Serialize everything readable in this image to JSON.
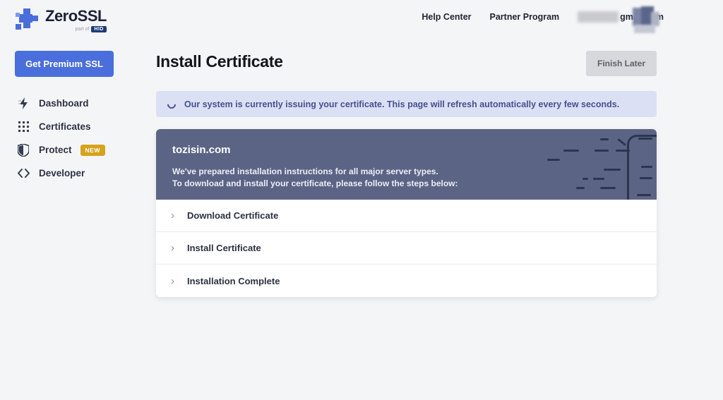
{
  "brand": {
    "name": "ZeroSSL",
    "part_of": "part of",
    "parent_badge": "HID"
  },
  "header": {
    "links": [
      {
        "label": "Help Center"
      },
      {
        "label": "Partner Program"
      }
    ],
    "account_email_visible": "gmail.com"
  },
  "sidebar": {
    "premium_button_label": "Get Premium SSL",
    "items": [
      {
        "label": "Dashboard",
        "icon": "lightning-icon"
      },
      {
        "label": "Certificates",
        "icon": "grid-icon"
      },
      {
        "label": "Protect",
        "icon": "shield-icon",
        "badge": "NEW"
      },
      {
        "label": "Developer",
        "icon": "code-icon"
      }
    ]
  },
  "main": {
    "title": "Install Certificate",
    "finish_later_label": "Finish Later",
    "banner": {
      "text": "Our system is currently issuing your certificate. This page will refresh automatically every few seconds."
    },
    "card": {
      "domain": "tozisin.com",
      "description_line1": "We've prepared installation instructions for all major server types.",
      "description_line2": "To download and install your certificate, please follow the steps below:",
      "steps": [
        {
          "label": "Download Certificate"
        },
        {
          "label": "Install Certificate"
        },
        {
          "label": "Installation Complete"
        }
      ]
    }
  },
  "colors": {
    "accent_blue": "#4a6edb",
    "banner_bg": "#dbe0f5",
    "banner_text": "#45518e",
    "card_header_bg": "#5c6485",
    "new_badge": "#d6a31d",
    "page_bg": "#f4f5f7"
  }
}
